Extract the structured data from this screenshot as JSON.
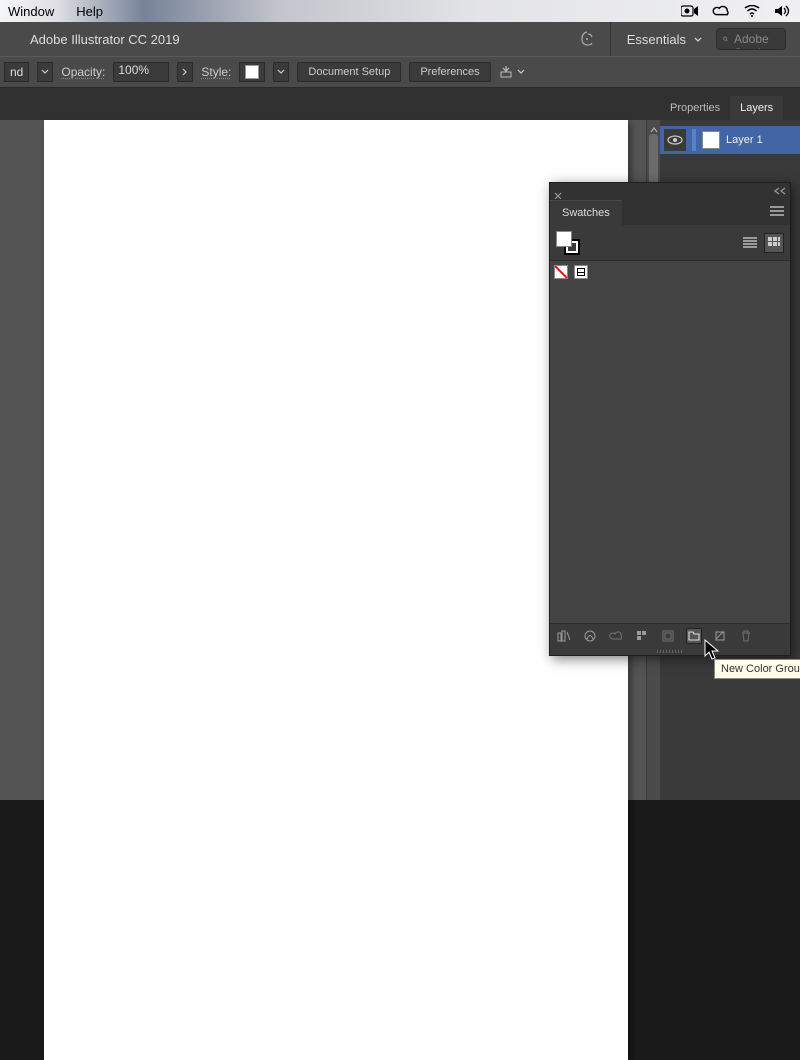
{
  "menubar": {
    "items": [
      "Window",
      "Help"
    ]
  },
  "appbar": {
    "title": "Adobe Illustrator CC 2019",
    "workspace": "Essentials",
    "search_placeholder": "Search Adobe Stock"
  },
  "ctrlbar": {
    "opacity_label": "Opacity:",
    "opacity_value": "100%",
    "style_label": "Style:",
    "docsetup": "Document Setup",
    "prefs": "Preferences",
    "first_dd": "nd"
  },
  "rpanel": {
    "tabs": [
      "Properties",
      "Layers"
    ],
    "active_tab": "Layers",
    "layers": [
      {
        "name": "Layer 1"
      }
    ]
  },
  "swatches": {
    "title": "Swatches"
  },
  "tooltip": "New Color Group"
}
